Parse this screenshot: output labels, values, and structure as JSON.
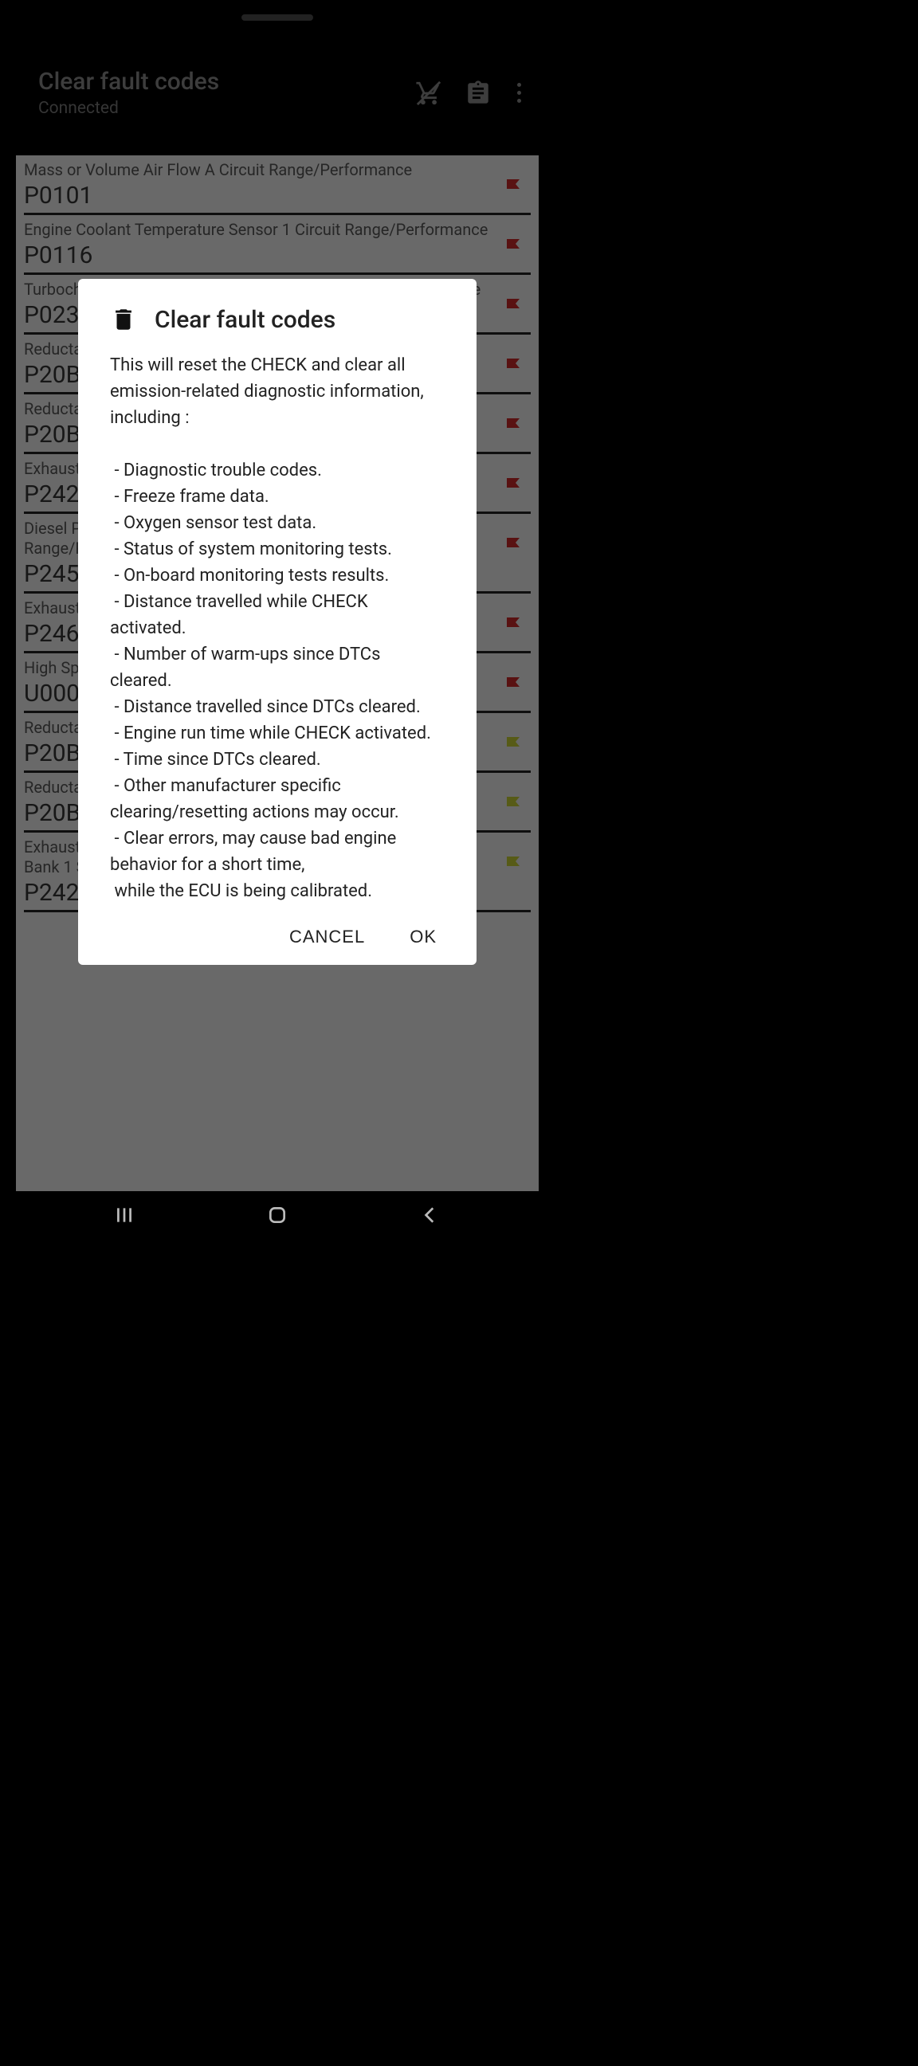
{
  "header": {
    "title": "Clear fault codes",
    "subtitle": "Connected"
  },
  "faults": [
    {
      "desc": "Mass or Volume Air Flow A Circuit Range/Performance",
      "code": "P0101",
      "flag": "red"
    },
    {
      "desc": "Engine Coolant Temperature Sensor 1 Circuit Range/Performance",
      "code": "P0116",
      "flag": "red"
    },
    {
      "desc": "Turbocharger/Supercharger Boost Sensor A Range/Performance",
      "code": "P0236",
      "flag": "red"
    },
    {
      "desc": "Reductant heater control A",
      "code": "P20BA",
      "flag": "red"
    },
    {
      "desc": "Reductant heater control B",
      "code": "P20BD",
      "flag": "red"
    },
    {
      "desc": "Exhaust Gas Temperature Sensor Bank 1 Sensor 3",
      "code": "P242A",
      "flag": "red"
    },
    {
      "desc": "Diesel Particulate Filter Differential Pressure Sensor Circuit Range/Performance",
      "code": "P2453",
      "flag": "red"
    },
    {
      "desc": "Exhaust Gas Temperature Sensor Bank 1 Sensor 4",
      "code": "P246E",
      "flag": "red"
    },
    {
      "desc": "High Speed CAN Communication Bus",
      "code": "U0001",
      "flag": "red"
    },
    {
      "desc": "Reductant heater control A - circuit open",
      "code": "P20B9",
      "flag": "yellow"
    },
    {
      "desc": "Reductant heater control A - circuit high",
      "code": "P20BC",
      "flag": "yellow"
    },
    {
      "desc": "Exhaust Gas Temperature Sensor Circuit Range/Performance Bank 1 Sensor 3",
      "code": "P242B",
      "flag": "yellow"
    }
  ],
  "dialog": {
    "title": "Clear fault codes",
    "body": "This will reset the CHECK and clear all emission-related diagnostic information, including :\n\n - Diagnostic trouble codes.\n - Freeze frame data.\n - Oxygen sensor test data.\n - Status of system monitoring tests.\n - On-board monitoring tests results.\n - Distance travelled while CHECK activated.\n - Number of warm-ups since DTCs cleared.\n - Distance travelled since DTCs cleared.\n - Engine run time while CHECK activated.\n - Time since DTCs cleared.\n - Other manufacturer specific clearing/resetting actions may occur.\n - Clear errors, may cause bad engine behavior for a short time,\n while the ECU is being calibrated.",
    "cancel": "CANCEL",
    "ok": "OK"
  },
  "flag_colors": {
    "red": "#c62828",
    "yellow": "#c0ca33"
  }
}
